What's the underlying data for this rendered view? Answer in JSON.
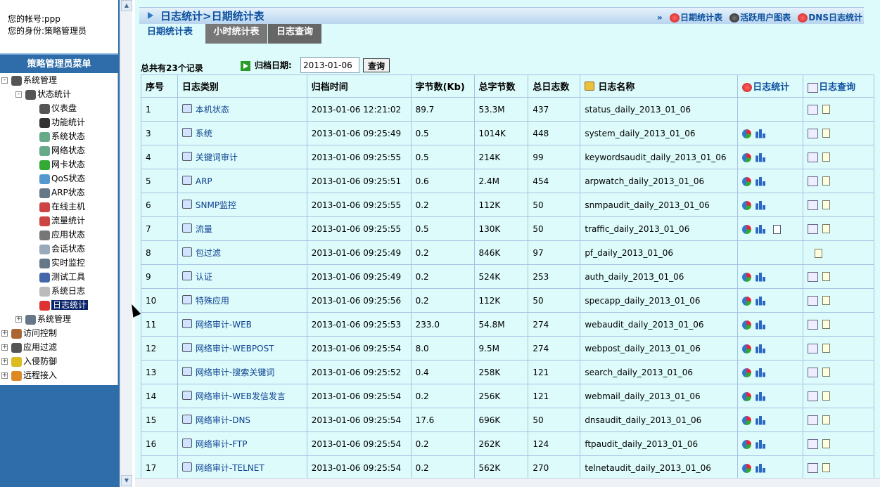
{
  "user": {
    "account_label": "您的帐号:",
    "account": "ppp",
    "role_label": "您的身份:",
    "role": "策略管理员"
  },
  "menu": {
    "title": "策略管理员菜单",
    "items": [
      {
        "label": "系统管理",
        "icon": "tree-icon",
        "level": 0,
        "toggle": "-"
      },
      {
        "label": "状态统计",
        "icon": "tree-icon",
        "level": 1,
        "toggle": "-"
      },
      {
        "label": "仪表盘",
        "icon": "tree-icon",
        "level": 2
      },
      {
        "label": "功能统计",
        "icon": "traffic-light-icon",
        "level": 2
      },
      {
        "label": "系统状态",
        "icon": "chart-icon",
        "level": 2
      },
      {
        "label": "网络状态",
        "icon": "chart-icon",
        "level": 2
      },
      {
        "label": "网卡状态",
        "icon": "nic-icon",
        "level": 2
      },
      {
        "label": "QoS状态",
        "icon": "funnel-icon",
        "level": 2
      },
      {
        "label": "ARP状态",
        "icon": "monitor-icon",
        "level": 2
      },
      {
        "label": "在线主机",
        "icon": "line-chart-icon",
        "level": 2
      },
      {
        "label": "流量统计",
        "icon": "line-chart-icon",
        "level": 2
      },
      {
        "label": "应用状态",
        "icon": "bar-chart-icon",
        "level": 2
      },
      {
        "label": "会话状态",
        "icon": "window-icon",
        "level": 2
      },
      {
        "label": "实时监控",
        "icon": "monitor-icon",
        "level": 2
      },
      {
        "label": "测试工具",
        "icon": "globe-icon",
        "level": 2
      },
      {
        "label": "系统日志",
        "icon": "doc-icon",
        "level": 2
      },
      {
        "label": "日志统计",
        "icon": "db-icon",
        "level": 2,
        "selected": true
      },
      {
        "label": "系统管理",
        "icon": "monitor-icon",
        "level": 1,
        "toggle": "+"
      },
      {
        "label": "访问控制",
        "icon": "wall-icon",
        "level": 0,
        "toggle": "+"
      },
      {
        "label": "应用过滤",
        "icon": "network-icon",
        "level": 0,
        "toggle": "+"
      },
      {
        "label": "入侵防御",
        "icon": "shield-icon",
        "level": 0,
        "toggle": "+"
      },
      {
        "label": "远程接入",
        "icon": "users-icon",
        "level": 0,
        "toggle": "+"
      }
    ]
  },
  "page": {
    "title": "日志统计>日期统计表",
    "links_prefix": "»",
    "links": [
      "日期统计表",
      "活跃用户图表",
      "DNS日志统计"
    ],
    "tabs": [
      "日期统计表",
      "小时统计表",
      "日志查询"
    ],
    "summary": "总共有23个记录",
    "date_label": "归档日期:",
    "date_value": "2013-01-06",
    "query_button": "查询"
  },
  "table": {
    "headers": [
      "序号",
      "日志类别",
      "归档时间",
      "字节数(Kb)",
      "总字节数",
      "总日志数",
      "日志名称",
      "日志统计",
      "日志查询"
    ],
    "rows": [
      {
        "no": "1",
        "cat": "本机状态",
        "time": "2013-01-06 12:21:02",
        "kb": "89.7",
        "total": "53.3M",
        "logs": "437",
        "name": "status_daily_2013_01_06",
        "stats": "",
        "query": "full"
      },
      {
        "no": "3",
        "cat": "系统",
        "time": "2013-01-06 09:25:49",
        "kb": "0.5",
        "total": "1014K",
        "logs": "448",
        "name": "system_daily_2013_01_06",
        "stats": "pb",
        "query": "full"
      },
      {
        "no": "4",
        "cat": "关键词审计",
        "time": "2013-01-06 09:25:55",
        "kb": "0.5",
        "total": "214K",
        "logs": "99",
        "name": "keywordsaudit_daily_2013_01_06",
        "stats": "pb",
        "query": "full"
      },
      {
        "no": "5",
        "cat": "ARP",
        "time": "2013-01-06 09:25:51",
        "kb": "0.6",
        "total": "2.4M",
        "logs": "454",
        "name": "arpwatch_daily_2013_01_06",
        "stats": "pb",
        "query": "full"
      },
      {
        "no": "6",
        "cat": "SNMP监控",
        "time": "2013-01-06 09:25:55",
        "kb": "0.2",
        "total": "112K",
        "logs": "50",
        "name": "snmpaudit_daily_2013_01_06",
        "stats": "pb",
        "query": "full"
      },
      {
        "no": "7",
        "cat": "流量",
        "time": "2013-01-06 09:25:55",
        "kb": "0.5",
        "total": "130K",
        "logs": "50",
        "name": "traffic_daily_2013_01_06",
        "stats": "pbd",
        "query": "full"
      },
      {
        "no": "8",
        "cat": "包过滤",
        "time": "2013-01-06 09:25:49",
        "kb": "0.2",
        "total": "846K",
        "logs": "97",
        "name": "pf_daily_2013_01_06",
        "stats": "",
        "query": "note"
      },
      {
        "no": "9",
        "cat": "认证",
        "time": "2013-01-06 09:25:49",
        "kb": "0.2",
        "total": "524K",
        "logs": "253",
        "name": "auth_daily_2013_01_06",
        "stats": "pb",
        "query": "full"
      },
      {
        "no": "10",
        "cat": "特殊应用",
        "time": "2013-01-06 09:25:56",
        "kb": "0.2",
        "total": "112K",
        "logs": "50",
        "name": "specapp_daily_2013_01_06",
        "stats": "pb",
        "query": "full"
      },
      {
        "no": "11",
        "cat": "网络审计-WEB",
        "time": "2013-01-06 09:25:53",
        "kb": "233.0",
        "total": "54.8M",
        "logs": "274",
        "name": "webaudit_daily_2013_01_06",
        "stats": "pb",
        "query": "full"
      },
      {
        "no": "12",
        "cat": "网络审计-WEBPOST",
        "time": "2013-01-06 09:25:54",
        "kb": "8.0",
        "total": "9.5M",
        "logs": "274",
        "name": "webpost_daily_2013_01_06",
        "stats": "pb",
        "query": "full"
      },
      {
        "no": "13",
        "cat": "网络审计-搜索关键词",
        "time": "2013-01-06 09:25:52",
        "kb": "0.4",
        "total": "258K",
        "logs": "121",
        "name": "search_daily_2013_01_06",
        "stats": "pb",
        "query": "full"
      },
      {
        "no": "14",
        "cat": "网络审计-WEB发信发言",
        "time": "2013-01-06 09:25:54",
        "kb": "0.2",
        "total": "256K",
        "logs": "121",
        "name": "webmail_daily_2013_01_06",
        "stats": "pb",
        "query": "full"
      },
      {
        "no": "15",
        "cat": "网络审计-DNS",
        "time": "2013-01-06 09:25:54",
        "kb": "17.6",
        "total": "696K",
        "logs": "50",
        "name": "dnsaudit_daily_2013_01_06",
        "stats": "pb",
        "query": "full"
      },
      {
        "no": "16",
        "cat": "网络审计-FTP",
        "time": "2013-01-06 09:25:54",
        "kb": "0.2",
        "total": "262K",
        "logs": "124",
        "name": "ftpaudit_daily_2013_01_06",
        "stats": "pb",
        "query": "full"
      },
      {
        "no": "17",
        "cat": "网络审计-TELNET",
        "time": "2013-01-06 09:25:54",
        "kb": "0.2",
        "total": "562K",
        "logs": "270",
        "name": "telnetaudit_daily_2013_01_06",
        "stats": "pb",
        "query": "full"
      }
    ]
  }
}
